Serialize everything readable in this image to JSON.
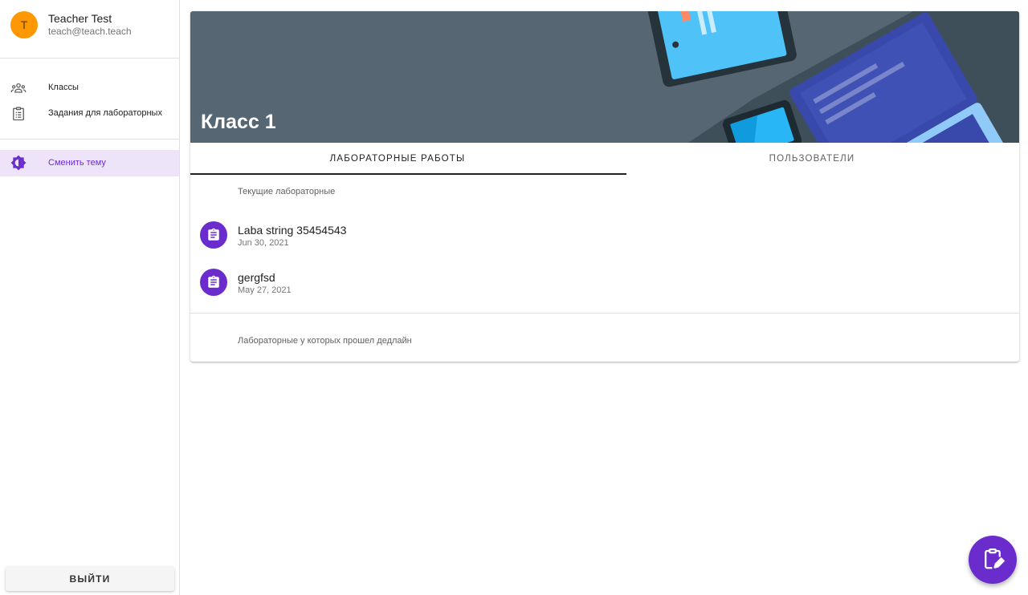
{
  "user": {
    "avatar_letter": "T",
    "name": "Teacher Test",
    "email": "teach@teach.teach"
  },
  "sidebar": {
    "items": [
      {
        "label": "Классы",
        "icon": "people-group-icon"
      },
      {
        "label": "Задания для лабораторных",
        "icon": "clipboard-list-icon"
      },
      {
        "label": "Сменить тему",
        "icon": "brightness-icon",
        "active": true
      }
    ],
    "logout_label": "ВЫЙТИ"
  },
  "class": {
    "title": "Класс 1"
  },
  "tabs": [
    {
      "label": "ЛАБОРАТОРНЫЕ РАБОТЫ",
      "active": true
    },
    {
      "label": "ПОЛЬЗОВАТЕЛИ",
      "active": false
    }
  ],
  "sections": {
    "current_label": "Текущие лабораторные",
    "past_label": "Лабораторные у которых прошел дедлайн"
  },
  "labs": [
    {
      "title": "Laba string 35454543",
      "date": "Jun 30, 2021",
      "icon": "assignment-icon"
    },
    {
      "title": "gergfsd",
      "date": "May 27, 2021",
      "icon": "assignment-icon"
    }
  ],
  "fab": {
    "icon": "clipboard-edit-icon"
  },
  "colors": {
    "accent": "#6a2ccc",
    "avatar": "#ff9800",
    "banner": "#566773",
    "active_item_bg": "#ede4fa"
  }
}
